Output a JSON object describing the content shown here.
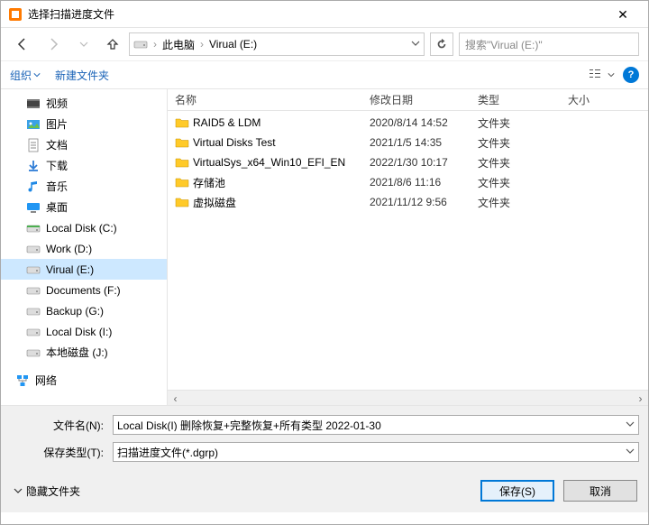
{
  "window": {
    "title": "选择扫描进度文件"
  },
  "nav": {
    "crumb1": "此电脑",
    "crumb2": "Virual (E:)",
    "search_placeholder": "搜索\"Virual (E:)\""
  },
  "toolbar": {
    "organize": "组织",
    "new_folder": "新建文件夹"
  },
  "sidebar": {
    "items": [
      {
        "label": "视频",
        "icon": "video"
      },
      {
        "label": "图片",
        "icon": "pictures"
      },
      {
        "label": "文档",
        "icon": "documents"
      },
      {
        "label": "下载",
        "icon": "downloads"
      },
      {
        "label": "音乐",
        "icon": "music"
      },
      {
        "label": "桌面",
        "icon": "desktop"
      },
      {
        "label": "Local Disk (C:)",
        "icon": "drive-c"
      },
      {
        "label": "Work (D:)",
        "icon": "drive"
      },
      {
        "label": "Virual (E:)",
        "icon": "drive"
      },
      {
        "label": "Documents (F:)",
        "icon": "drive"
      },
      {
        "label": "Backup (G:)",
        "icon": "drive"
      },
      {
        "label": "Local Disk (I:)",
        "icon": "drive"
      },
      {
        "label": "本地磁盘 (J:)",
        "icon": "drive"
      }
    ],
    "network": "网络"
  },
  "columns": {
    "name": "名称",
    "modified": "修改日期",
    "type": "类型",
    "size": "大小"
  },
  "files": [
    {
      "name": "RAID5 & LDM",
      "date": "2020/8/14 14:52",
      "type": "文件夹"
    },
    {
      "name": "Virtual Disks Test",
      "date": "2021/1/5 14:35",
      "type": "文件夹"
    },
    {
      "name": "VirtualSys_x64_Win10_EFI_EN",
      "date": "2022/1/30 10:17",
      "type": "文件夹"
    },
    {
      "name": "存储池",
      "date": "2021/8/6 11:16",
      "type": "文件夹"
    },
    {
      "name": "虚拟磁盘",
      "date": "2021/11/12 9:56",
      "type": "文件夹"
    }
  ],
  "fields": {
    "filename_label": "文件名(N):",
    "filename_value": "Local Disk(I) 删除恢复+完整恢复+所有类型 2022-01-30",
    "filetype_label": "保存类型(T):",
    "filetype_value": "扫描进度文件(*.dgrp)"
  },
  "footer": {
    "hide_folders": "隐藏文件夹",
    "save": "保存(S)",
    "cancel": "取消"
  },
  "colors": {
    "accent": "#0078d7",
    "folder": "#ffca28",
    "link": "#1a63b7"
  }
}
